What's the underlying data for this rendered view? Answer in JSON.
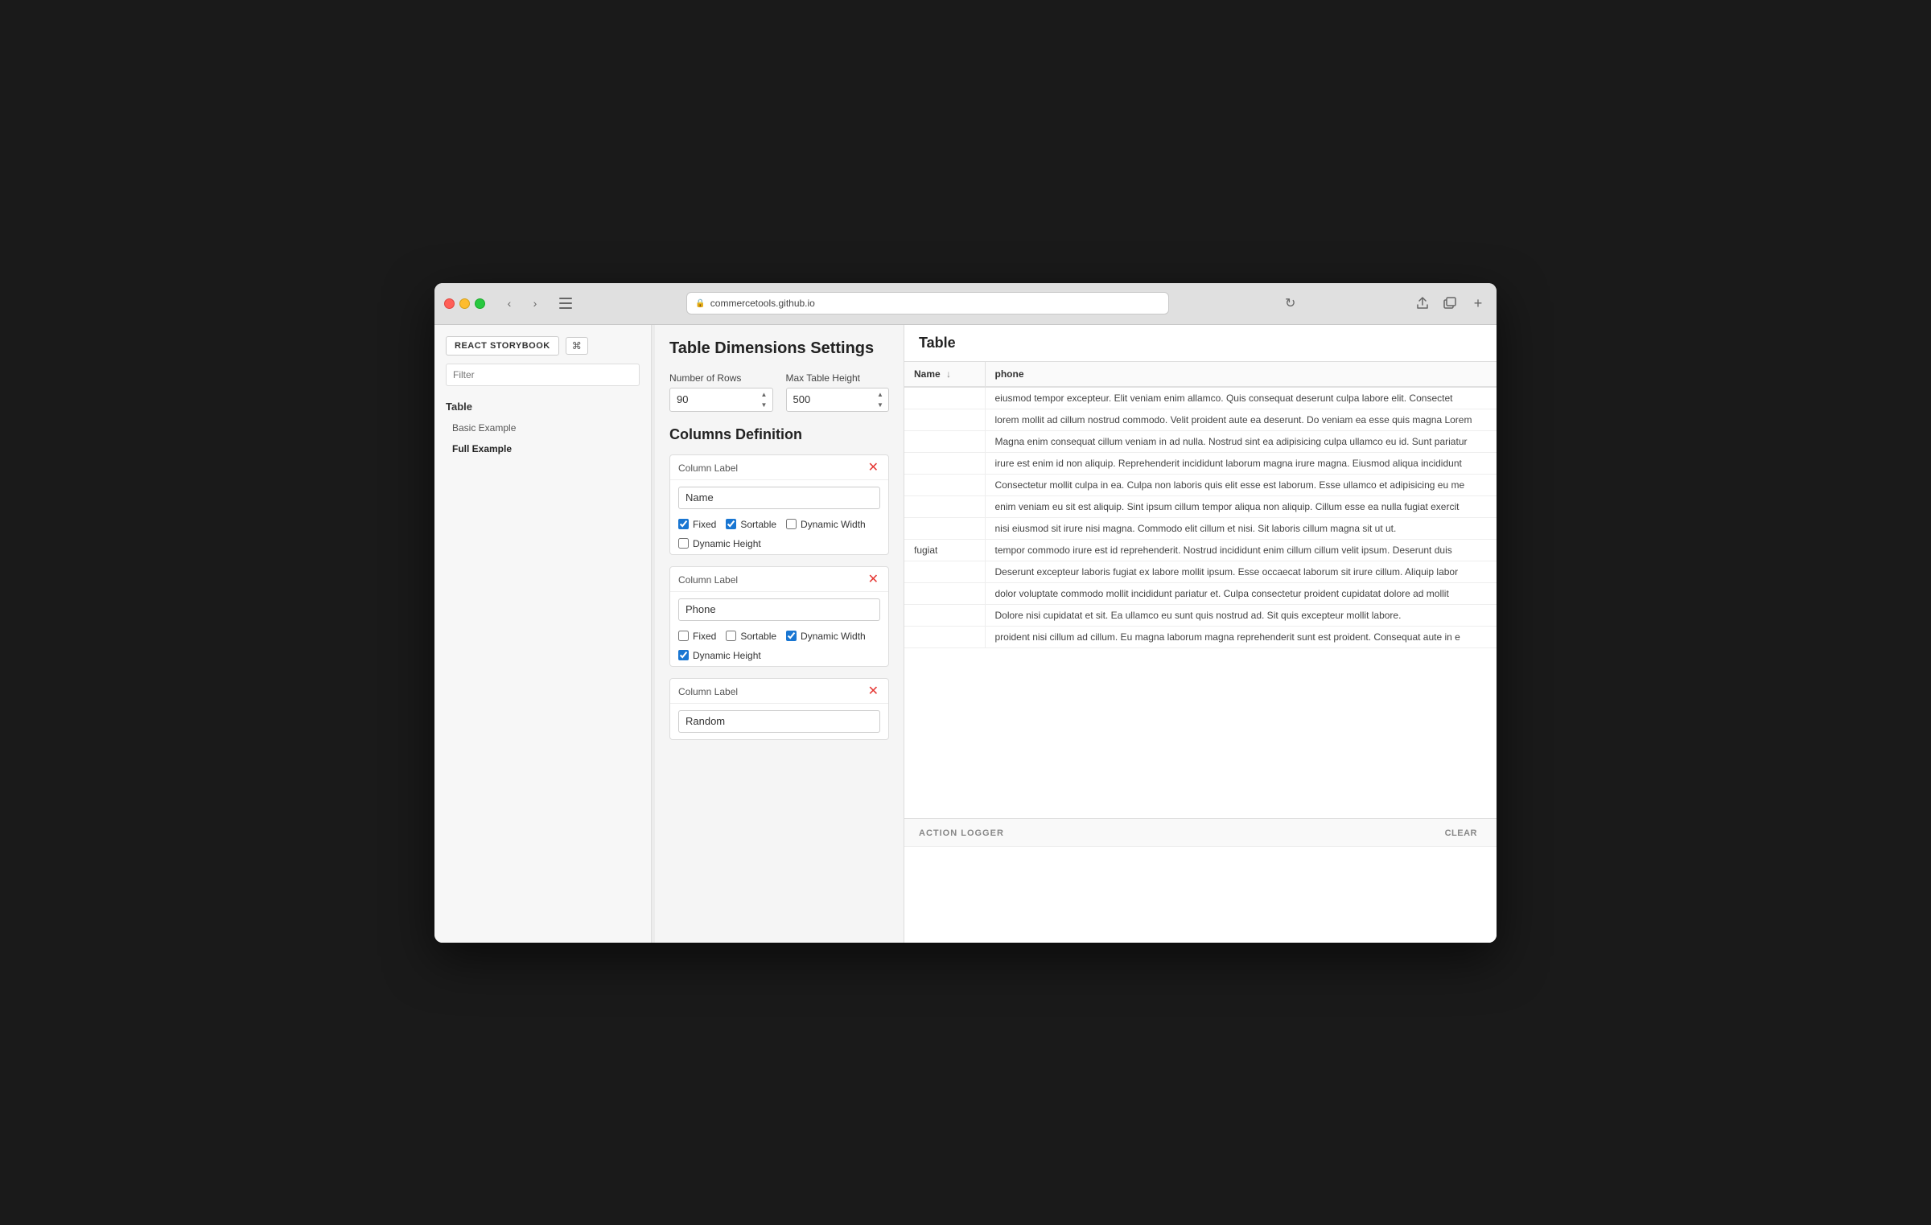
{
  "browser": {
    "url": "commercetools.github.io",
    "reload_label": "↻"
  },
  "sidebar": {
    "brand_label": "REACT STORYBOOK",
    "keyboard_shortcut": "⌘",
    "filter_placeholder": "Filter",
    "section_label": "Table",
    "items": [
      {
        "label": "Basic Example",
        "active": false
      },
      {
        "label": "Full Example",
        "active": true
      }
    ]
  },
  "controls": {
    "title": "Table Dimensions Settings",
    "rows_label": "Number of Rows",
    "rows_value": "90",
    "height_label": "Max Table Height",
    "height_value": "500",
    "columns_title": "Columns Definition",
    "columns": [
      {
        "id": "col1",
        "label_placeholder": "Column Label",
        "value": "Name",
        "fixed": true,
        "sortable": true,
        "dynamic_width": false,
        "dynamic_height": false
      },
      {
        "id": "col2",
        "label_placeholder": "Column Label",
        "value": "Phone",
        "fixed": false,
        "sortable": false,
        "dynamic_width": true,
        "dynamic_height": true
      },
      {
        "id": "col3",
        "label_placeholder": "Column Label",
        "value": "Random",
        "fixed": false,
        "sortable": false,
        "dynamic_width": false,
        "dynamic_height": false
      }
    ],
    "checkbox_labels": {
      "fixed": "Fixed",
      "sortable": "Sortable",
      "dynamic_width": "Dynamic Width",
      "dynamic_height": "Dynamic Height"
    }
  },
  "table": {
    "title": "Table",
    "col_name": "Name",
    "col_name_sort": "↓",
    "col_phone": "phone",
    "rows": [
      {
        "name": "",
        "phone": "eiusmod tempor excepteur. Elit veniam enim allamco. Quis consequat deserunt culpa labore elit. Consectet"
      },
      {
        "name": "",
        "phone": "lorem mollit ad cillum nostrud commodo. Velit proident aute ea deserunt. Do veniam ea esse quis magna Lorem"
      },
      {
        "name": "",
        "phone": "Magna enim consequat cillum veniam in ad nulla. Nostrud sint ea adipisicing culpa ullamco eu id. Sunt pariatur"
      },
      {
        "name": "",
        "phone": "irure est enim id non aliquip. Reprehenderit incididunt laborum magna irure magna. Eiusmod aliqua incididunt"
      },
      {
        "name": "",
        "phone": "Consectetur mollit culpa in ea. Culpa non laboris quis elit esse est laborum. Esse ullamco et adipisicing eu me"
      },
      {
        "name": "",
        "phone": "enim veniam eu sit est aliquip. Sint ipsum cillum tempor aliqua non aliquip. Cillum esse ea nulla fugiat exercit"
      },
      {
        "name": "",
        "phone": "nisi eiusmod sit irure nisi magna. Commodo elit cillum et nisi. Sit laboris cillum magna sit ut ut."
      },
      {
        "name": "fugiat",
        "phone": "tempor commodo irure est id reprehenderit. Nostrud incididunt enim cillum cillum velit ipsum. Deserunt duis"
      },
      {
        "name": "",
        "phone": "Deserunt excepteur laboris fugiat ex labore mollit ipsum. Esse occaecat laborum sit irure cillum. Aliquip labor"
      },
      {
        "name": "",
        "phone": "dolor voluptate commodo mollit incididunt pariatur et. Culpa consectetur proident cupidatat dolore ad mollit"
      },
      {
        "name": "",
        "phone": "Dolore nisi cupidatat et sit. Ea ullamco eu sunt quis nostrud ad. Sit quis excepteur mollit labore."
      },
      {
        "name": "",
        "phone": "proident nisi cillum ad cillum. Eu magna laborum magna reprehenderit sunt est proident. Consequat aute in e"
      }
    ]
  },
  "action_logger": {
    "title": "ACTION LOGGER",
    "clear_label": "CLEAR"
  }
}
